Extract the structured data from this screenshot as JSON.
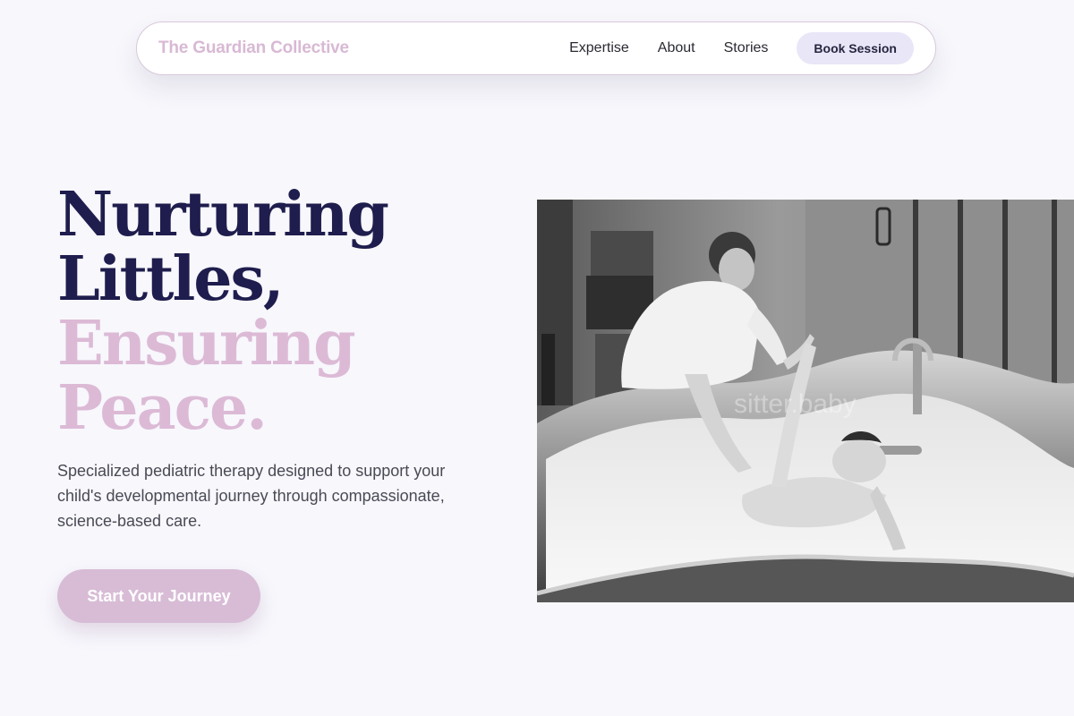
{
  "nav": {
    "brand": "The Guardian Collective",
    "links": [
      "Expertise",
      "About",
      "Stories"
    ],
    "cta_label": "Book Session"
  },
  "hero": {
    "title_lines": [
      "Nurturing",
      "Littles,",
      "Ensuring",
      "Peace."
    ],
    "description": "Specialized pediatric therapy designed to support your child's developmental journey through compassionate, science-based care.",
    "cta_label": "Start Your Journey"
  },
  "photo": {
    "description": "black-and-white photo of a therapist guiding a patient's arm in a large steel hydrotherapy tub",
    "watermark": "sitter.baby"
  },
  "colors": {
    "background": "#f7f7fc",
    "brand_pink": "#dcbad6",
    "title_navy": "#1f1d4d",
    "book_button_bg": "#e9e6f8"
  }
}
